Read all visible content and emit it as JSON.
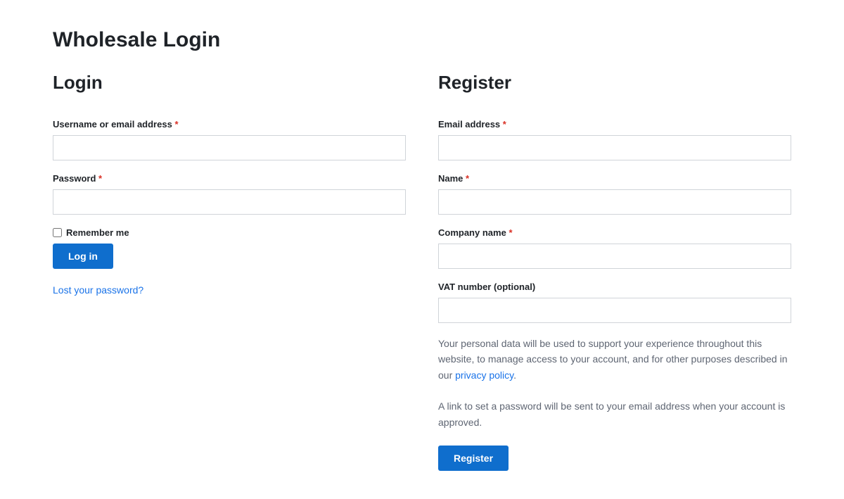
{
  "page": {
    "title": "Wholesale Login"
  },
  "login": {
    "heading": "Login",
    "username_label": "Username or email address",
    "password_label": "Password",
    "remember_label": "Remember me",
    "submit_label": "Log in",
    "lost_password_text": "Lost your password?",
    "required_mark": "*"
  },
  "register": {
    "heading": "Register",
    "email_label": "Email address",
    "name_label": "Name",
    "company_label": "Company name",
    "vat_label": "VAT number (optional)",
    "privacy_text_part1": "Your personal data will be used to support your experience throughout this website, to manage access to your account, and for other purposes described in our ",
    "privacy_link_text": "privacy policy",
    "privacy_text_part2": ".",
    "password_notice": "A link to set a password will be sent to your email address when your account is approved.",
    "submit_label": "Register",
    "required_mark": "*"
  }
}
